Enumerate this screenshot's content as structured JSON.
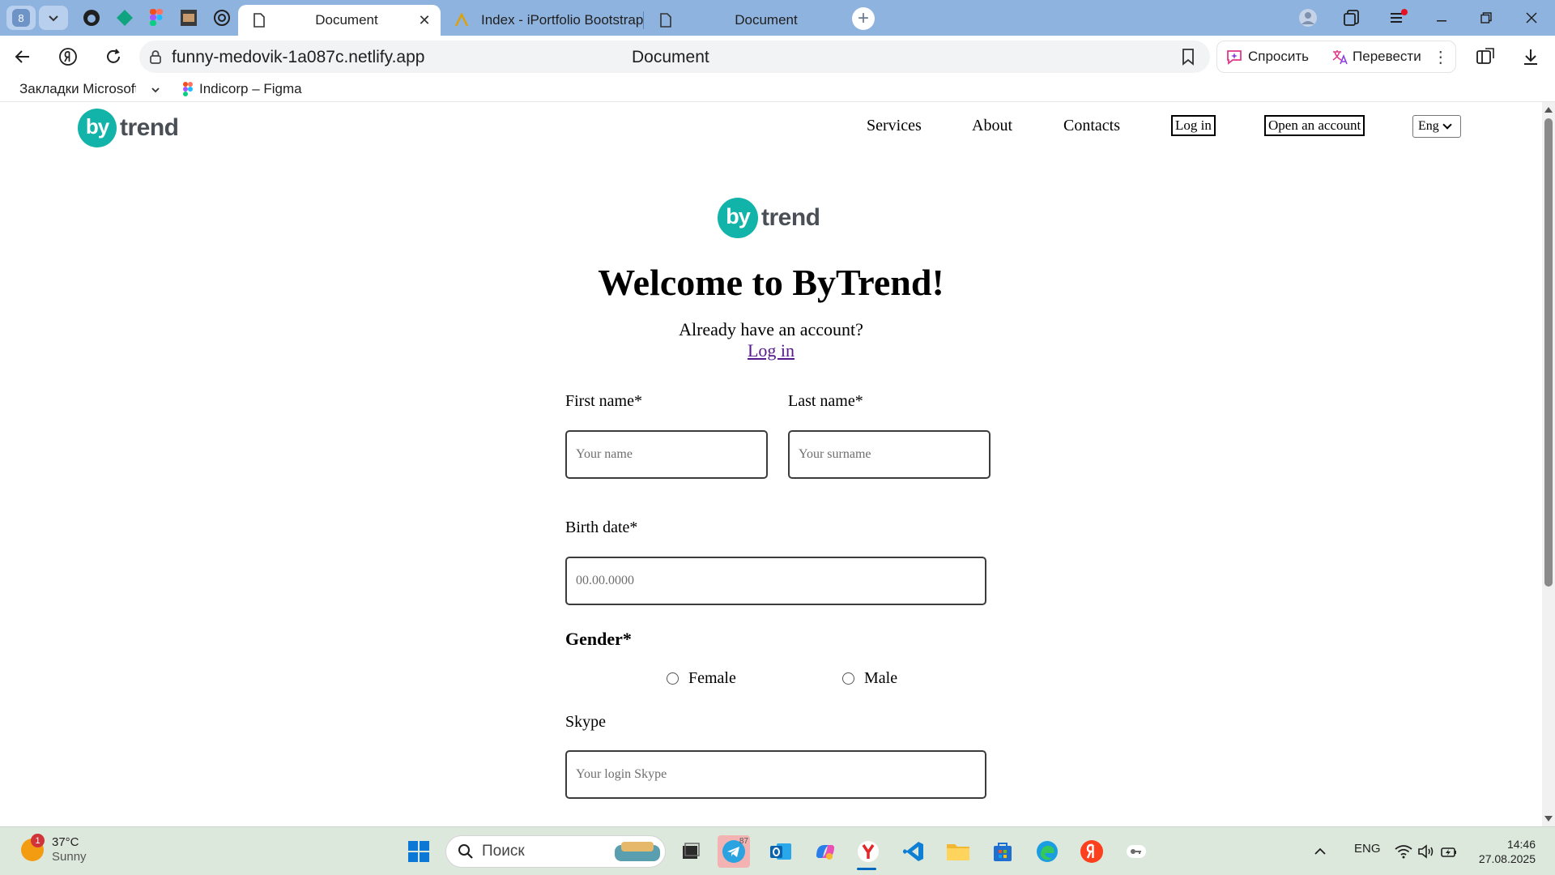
{
  "browser": {
    "tab_group_count": "8",
    "tabs": [
      {
        "title": "Document",
        "active": true
      },
      {
        "title": "Index - iPortfolio Bootstrap",
        "active": false
      },
      {
        "title": "Document",
        "active": false
      }
    ],
    "address": {
      "url": "funny-medovik-1a087c.netlify.app",
      "page_title": "Document"
    },
    "ai_buttons": {
      "ask": "Спросить",
      "translate": "Перевести"
    },
    "bookmarks": [
      {
        "label": "Закладки Microsoft Edge"
      },
      {
        "label": "Indicorp – Figma"
      }
    ]
  },
  "site": {
    "logo": {
      "mark": "by",
      "word": "trend"
    },
    "nav": {
      "services": "Services",
      "about": "About",
      "contacts": "Contacts",
      "login": "Log in",
      "open_account": "Open an account",
      "language": "Eng"
    },
    "heading": "Welcome to ByTrend!",
    "already": "Already have an account?",
    "login_link": "Log in",
    "form": {
      "first_name_label": "First name*",
      "first_name_placeholder": "Your name",
      "last_name_label": "Last name*",
      "last_name_placeholder": "Your surname",
      "birth_label": "Birth date*",
      "birth_placeholder": "00.00.0000",
      "gender_label": "Gender*",
      "gender_options": [
        "Female",
        "Male"
      ],
      "skype_label": "Skype",
      "skype_placeholder": "Your login Skype"
    }
  },
  "taskbar": {
    "weather": {
      "temp": "37°C",
      "condition": "Sunny",
      "badge": "1"
    },
    "search_placeholder": "Поиск",
    "telegram_badge": "87",
    "language": "ENG",
    "time": "14:46",
    "date": "27.08.2025"
  },
  "colors": {
    "brand_teal": "#12b3a8",
    "tab_strip": "#8fb3df",
    "visited_link": "#551a8b"
  }
}
